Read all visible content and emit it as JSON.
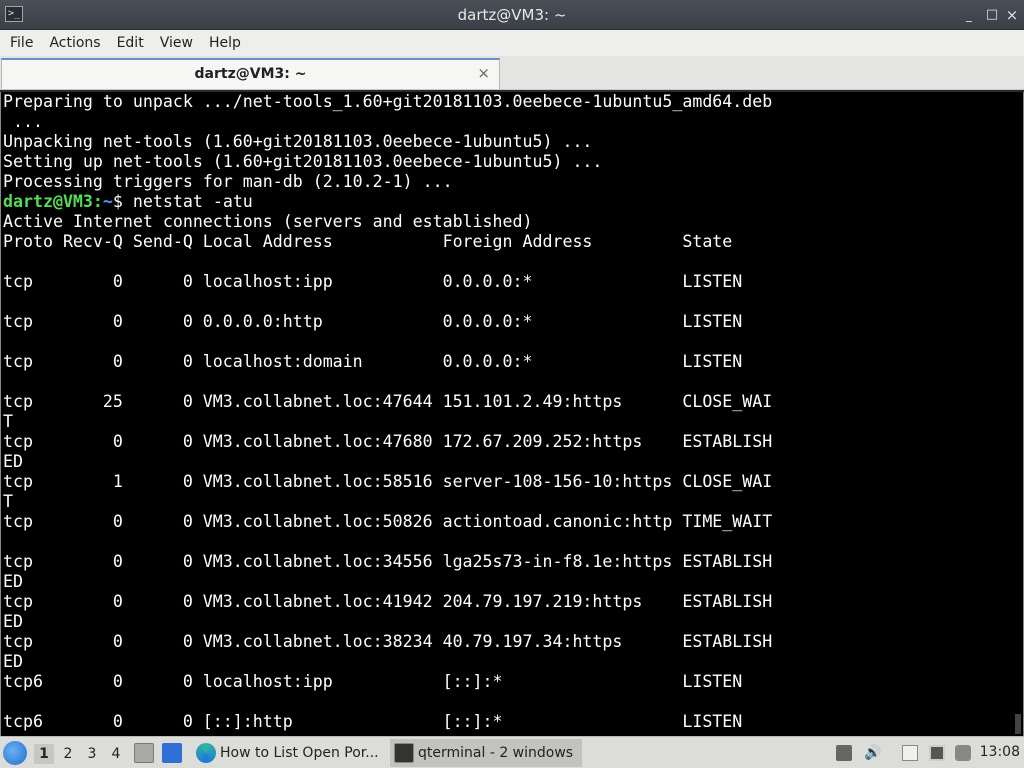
{
  "window": {
    "title": "dartz@VM3: ~",
    "minimize": "_",
    "maximize": "□",
    "close": "×"
  },
  "menu": [
    "File",
    "Actions",
    "Edit",
    "View",
    "Help"
  ],
  "tab": {
    "label": "dartz@VM3: ~",
    "close": "×"
  },
  "terminal": {
    "prompt_user": "dartz@VM3",
    "prompt_path": "~",
    "prompt_symbol": "$",
    "command": " netstat -atu",
    "lines_before": [
      "Preparing to unpack .../net-tools_1.60+git20181103.0eebece-1ubuntu5_amd64.deb",
      " ...",
      "Unpacking net-tools (1.60+git20181103.0eebece-1ubuntu5) ...",
      "Setting up net-tools (1.60+git20181103.0eebece-1ubuntu5) ...",
      "Processing triggers for man-db (2.10.2-1) ..."
    ],
    "lines_after": [
      "Active Internet connections (servers and established)",
      "Proto Recv-Q Send-Q Local Address           Foreign Address         State",
      "",
      "tcp        0      0 localhost:ipp           0.0.0.0:*               LISTEN",
      "",
      "tcp        0      0 0.0.0.0:http            0.0.0.0:*               LISTEN",
      "",
      "tcp        0      0 localhost:domain        0.0.0.0:*               LISTEN",
      "",
      "tcp       25      0 VM3.collabnet.loc:47644 151.101.2.49:https      CLOSE_WAI",
      "T",
      "tcp        0      0 VM3.collabnet.loc:47680 172.67.209.252:https    ESTABLISH",
      "ED",
      "tcp        1      0 VM3.collabnet.loc:58516 server-108-156-10:https CLOSE_WAI",
      "T",
      "tcp        0      0 VM3.collabnet.loc:50826 actiontoad.canonic:http TIME_WAIT",
      "",
      "tcp        0      0 VM3.collabnet.loc:34556 lga25s73-in-f8.1e:https ESTABLISH",
      "ED",
      "tcp        0      0 VM3.collabnet.loc:41942 204.79.197.219:https    ESTABLISH",
      "ED",
      "tcp        0      0 VM3.collabnet.loc:38234 40.79.197.34:https      ESTABLISH",
      "ED",
      "tcp6       0      0 localhost:ipp           [::]:*                  LISTEN",
      "",
      "tcp6       0      0 [::]:http               [::]:*                  LISTEN"
    ]
  },
  "taskbar": {
    "workspaces": [
      "1",
      "2",
      "3",
      "4"
    ],
    "tasks": [
      {
        "label": "How to List Open Por..."
      },
      {
        "label": "qterminal - 2 windows"
      }
    ],
    "clock": "13:08",
    "colors": {
      "terminal_bg": "#000000",
      "prompt_user": "#55dd55",
      "prompt_path": "#5599ff"
    }
  }
}
